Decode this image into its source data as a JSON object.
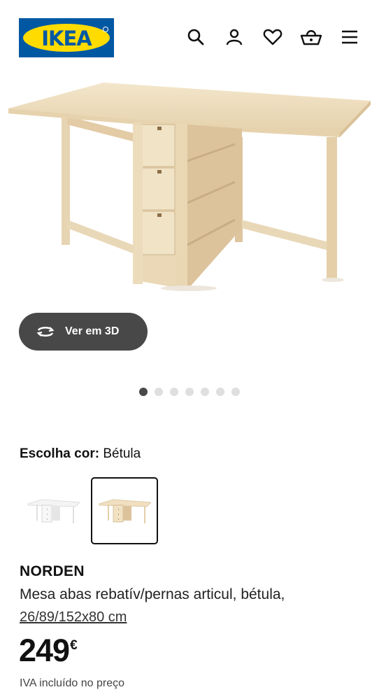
{
  "header": {
    "logo_text": "IKEA",
    "icons": [
      "search-icon",
      "user-icon",
      "heart-icon",
      "basket-icon",
      "menu-icon"
    ]
  },
  "gallery": {
    "view3d_label": "Ver em 3D",
    "image_count": 7,
    "active_index": 0
  },
  "color_picker": {
    "label": "Escolha cor:",
    "value": "Bétula",
    "options": [
      {
        "name": "white",
        "swatch": "#f2f2f2",
        "selected": false
      },
      {
        "name": "birch",
        "swatch": "#e8d3b0",
        "selected": true
      }
    ]
  },
  "product": {
    "name": "NORDEN",
    "description": "Mesa abas rebatív/pernas articul, bétula,",
    "dimensions": "26/89/152x80 cm",
    "price": "249",
    "currency": "€",
    "vat_note": "IVA incluído no preço"
  },
  "colors": {
    "brand_blue": "#0058a3",
    "brand_yellow": "#ffdb00",
    "button_dark": "#484848",
    "wood": "#ecdcbe"
  }
}
